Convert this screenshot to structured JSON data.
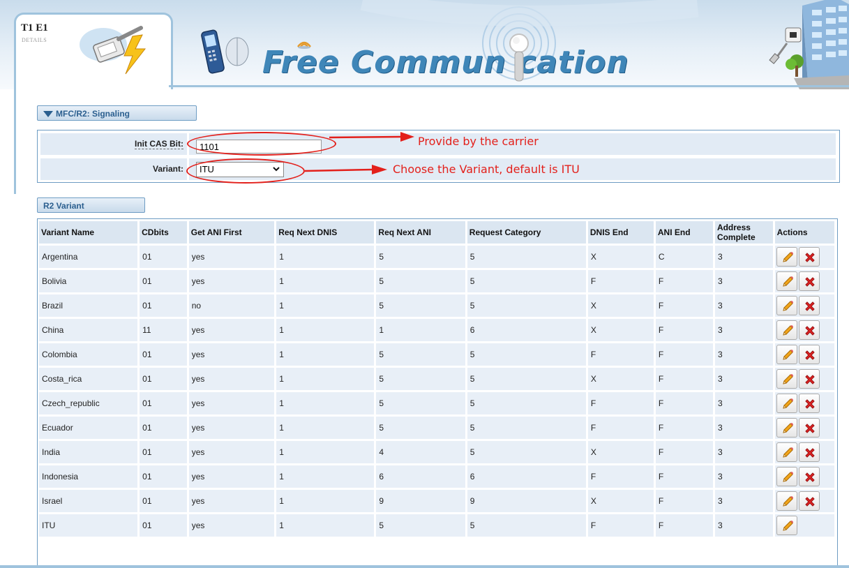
{
  "header": {
    "logo_title": "T1 E1",
    "logo_subtitle": "DETAILS",
    "brand_title": "Free Commun   cation"
  },
  "signaling": {
    "section_title": "MFC/R2: Signaling",
    "init_cas_label": "Init CAS Bit:",
    "init_cas_value": "1101",
    "variant_label": "Variant:",
    "variant_value": "ITU"
  },
  "annotations": {
    "carrier_note": "Provide by the carrier",
    "variant_note": "Choose the Variant, default is ITU",
    "color": "#e3201b"
  },
  "r2_variant": {
    "section_title": "R2 Variant",
    "columns": [
      "Variant Name",
      "CDbits",
      "Get ANI First",
      "Req Next DNIS",
      "Req Next ANI",
      "Request Category",
      "DNIS End",
      "ANI End",
      "Address Complete",
      "Actions"
    ],
    "rows": [
      [
        "Argentina",
        "01",
        "yes",
        "1",
        "5",
        "5",
        "X",
        "C",
        "3"
      ],
      [
        "Bolivia",
        "01",
        "yes",
        "1",
        "5",
        "5",
        "F",
        "F",
        "3"
      ],
      [
        "Brazil",
        "01",
        "no",
        "1",
        "5",
        "5",
        "X",
        "F",
        "3"
      ],
      [
        "China",
        "11",
        "yes",
        "1",
        "1",
        "6",
        "X",
        "F",
        "3"
      ],
      [
        "Colombia",
        "01",
        "yes",
        "1",
        "5",
        "5",
        "F",
        "F",
        "3"
      ],
      [
        "Costa_rica",
        "01",
        "yes",
        "1",
        "5",
        "5",
        "X",
        "F",
        "3"
      ],
      [
        "Czech_republic",
        "01",
        "yes",
        "1",
        "5",
        "5",
        "F",
        "F",
        "3"
      ],
      [
        "Ecuador",
        "01",
        "yes",
        "1",
        "5",
        "5",
        "F",
        "F",
        "3"
      ],
      [
        "India",
        "01",
        "yes",
        "1",
        "4",
        "5",
        "X",
        "F",
        "3"
      ],
      [
        "Indonesia",
        "01",
        "yes",
        "1",
        "6",
        "6",
        "F",
        "F",
        "3"
      ],
      [
        "Israel",
        "01",
        "yes",
        "1",
        "9",
        "9",
        "X",
        "F",
        "3"
      ],
      [
        "ITU",
        "01",
        "yes",
        "1",
        "5",
        "5",
        "F",
        "F",
        "3"
      ]
    ],
    "deletable": [
      true,
      true,
      true,
      true,
      true,
      true,
      true,
      true,
      true,
      true,
      true,
      false
    ]
  },
  "colors": {
    "accent": "#3f86b8",
    "border": "#6d9cc3",
    "row_bg": "#e8eff7",
    "header_bg": "#dbe6f1"
  }
}
